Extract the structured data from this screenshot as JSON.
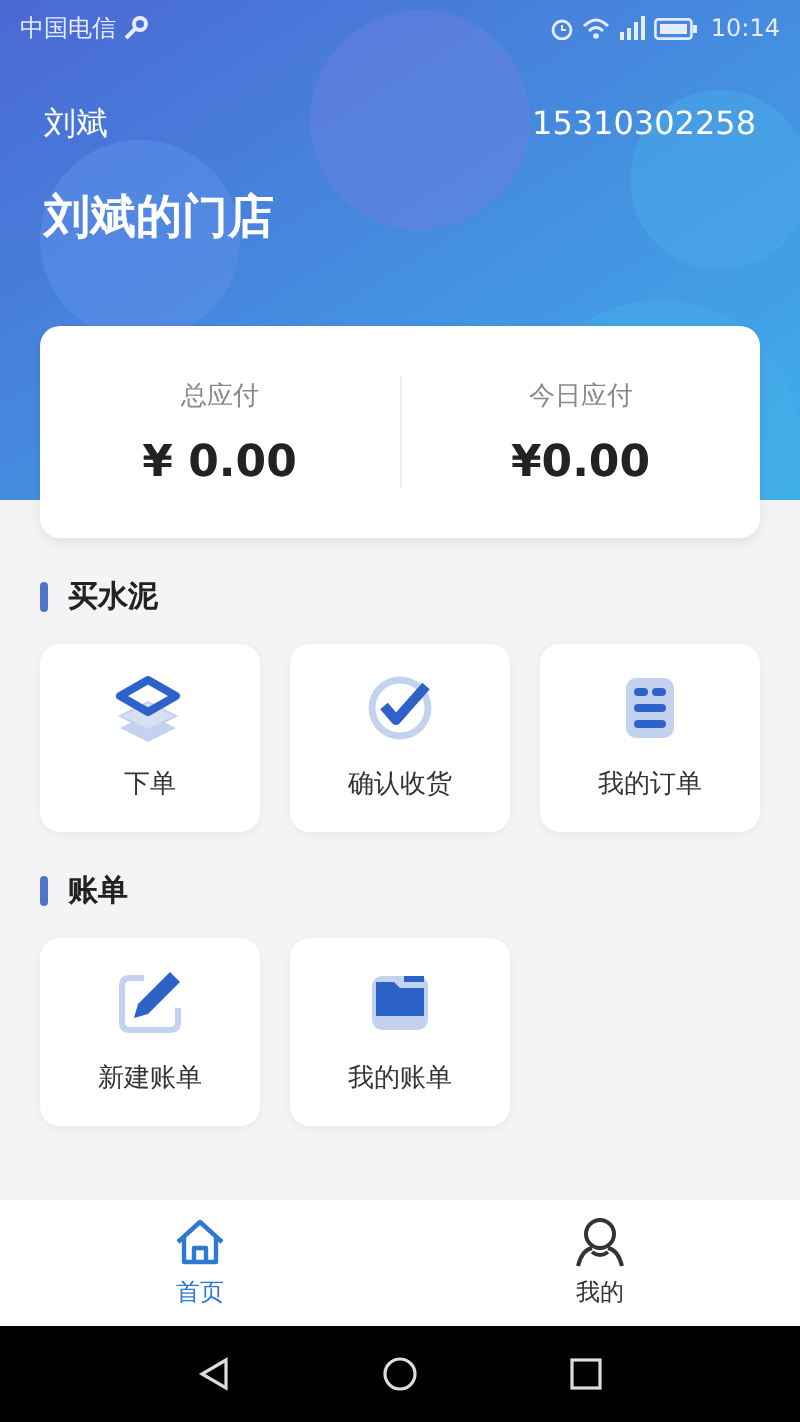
{
  "status_bar": {
    "carrier": "中国电信",
    "time": "10:14"
  },
  "header": {
    "user_name": "刘斌",
    "phone": "15310302258",
    "store_title": "刘斌的门店"
  },
  "summary": [
    {
      "label": "总应付",
      "value": "¥ 0.00"
    },
    {
      "label": "今日应付",
      "value": "¥0.00"
    }
  ],
  "sections": [
    {
      "title": "买水泥",
      "items": [
        {
          "label": "下单"
        },
        {
          "label": "确认收货"
        },
        {
          "label": "我的订单"
        }
      ]
    },
    {
      "title": "账单",
      "items": [
        {
          "label": "新建账单"
        },
        {
          "label": "我的账单"
        }
      ]
    }
  ],
  "tab_bar": [
    {
      "label": "首页",
      "selected": true
    },
    {
      "label": "我的",
      "selected": false
    }
  ]
}
